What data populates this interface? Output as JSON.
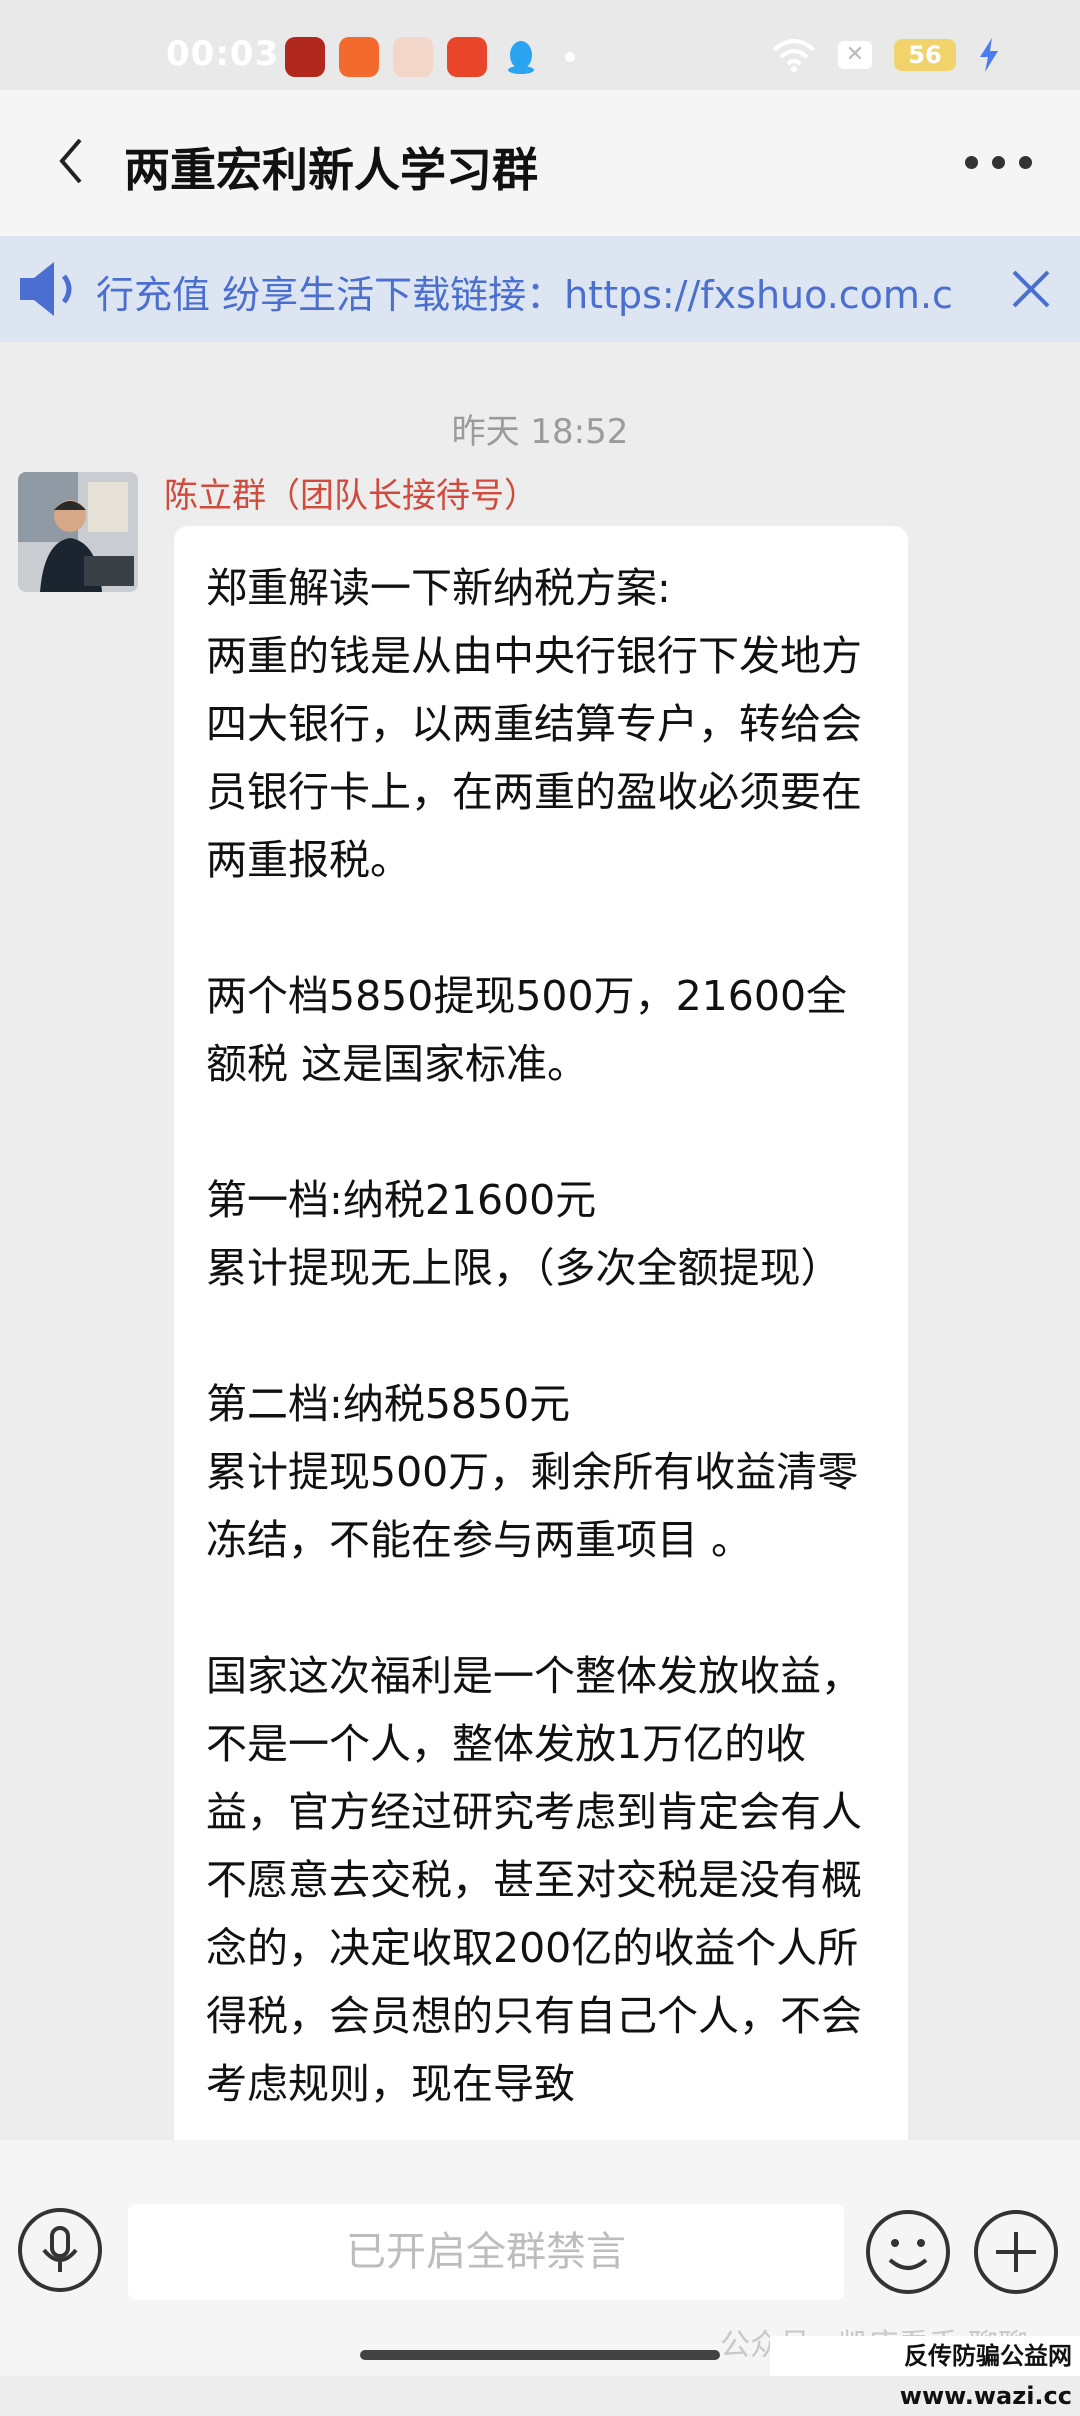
{
  "status_bar": {
    "time": "00:03",
    "battery": "56"
  },
  "header": {
    "title": "两重宏利新人学习群"
  },
  "notice": {
    "text": "行充值 纷享生活下载链接：https://fxshuo.com.c"
  },
  "chat": {
    "timestamp": "昨天 18:52",
    "message": {
      "sender": "陈立群（团队长接待号）",
      "text": "郑重解读一下新纳税方案:\n两重的钱是从由中央行银行下发地方四大银行，以两重结算专户，转给会员银行卡上，在两重的盈收必须要在两重报税。\n\n两个档5850提现500万，21600全额税 这是国家标准。\n\n第一档:纳税21600元\n累计提现无上限，（多次全额提现）\n\n第二档:纳税5850元\n累计提现500万，剩余所有收益清零冻结，不能在参与两重项目 。\n\n国家这次福利是一个整体发放收益， 不是一个人，整体发放1万亿的收益，官方经过研究考虑到肯定会有人不愿意去交税，甚至对交税是没有概念的，决定收取200亿的收益个人所得税，会员想的只有自己个人，不会考虑规则，现在导致"
    }
  },
  "input": {
    "placeholder": "已开启全群禁言"
  },
  "watermark": {
    "text": "公众号 · 凯唐看手·聊聊",
    "site": "反传防骗公益网 www.wazi.cc"
  }
}
